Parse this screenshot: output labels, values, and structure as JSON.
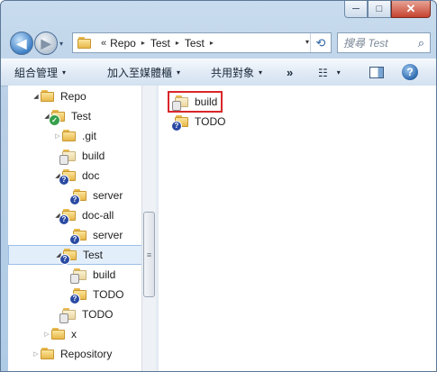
{
  "window": {
    "caption": {
      "minimize": "─",
      "maximize": "□",
      "close": "✕"
    }
  },
  "nav": {
    "back": "◀",
    "forward": "▶",
    "dropdown": "▾"
  },
  "address": {
    "chevron": "«",
    "crumbs": [
      "Repo",
      "Test",
      "Test"
    ],
    "separator": "▸",
    "dropdown": "▾",
    "refresh": "⟲"
  },
  "search": {
    "placeholder": "搜尋 Test",
    "icon": "⌕"
  },
  "toolbar": {
    "organize": "組合管理",
    "include": "加入至媒體櫃",
    "share": "共用對象",
    "more": "»",
    "views_icon": "☷",
    "caret": "▾",
    "help": "?"
  },
  "tree": [
    {
      "label": "Repo",
      "badge": "none",
      "arrow": "expanded",
      "level": 1
    },
    {
      "label": "Test",
      "badge": "ok",
      "arrow": "expanded",
      "level": 2
    },
    {
      "label": ".git",
      "badge": "none",
      "arrow": "collapsed",
      "level": 3
    },
    {
      "label": "build",
      "badge": "db",
      "arrow": "none",
      "level": 3
    },
    {
      "label": "doc",
      "badge": "question",
      "arrow": "expanded",
      "level": 3
    },
    {
      "label": "server",
      "badge": "question",
      "arrow": "none",
      "level": 4
    },
    {
      "label": "doc-all",
      "badge": "question",
      "arrow": "expanded",
      "level": 3
    },
    {
      "label": "server",
      "badge": "question",
      "arrow": "none",
      "level": 4
    },
    {
      "label": "Test",
      "badge": "question",
      "arrow": "expanded",
      "level": 3,
      "selected": true
    },
    {
      "label": "build",
      "badge": "db",
      "arrow": "none",
      "level": 4
    },
    {
      "label": "TODO",
      "badge": "question",
      "arrow": "none",
      "level": 4
    },
    {
      "label": "TODO",
      "badge": "db",
      "arrow": "none",
      "level": 3
    },
    {
      "label": "x",
      "badge": "none",
      "arrow": "collapsed",
      "level": 2
    },
    {
      "label": "Repository",
      "badge": "none",
      "arrow": "collapsed",
      "level": 1
    }
  ],
  "content": [
    {
      "label": "build",
      "badge": "db",
      "highlighted": true
    },
    {
      "label": "TODO",
      "badge": "question",
      "highlighted": false
    }
  ],
  "scrollbar_grip": "≡",
  "colors": {
    "highlight_border": "#d9262a",
    "selection": "#e3eefb",
    "folder": "#e8b94b"
  }
}
